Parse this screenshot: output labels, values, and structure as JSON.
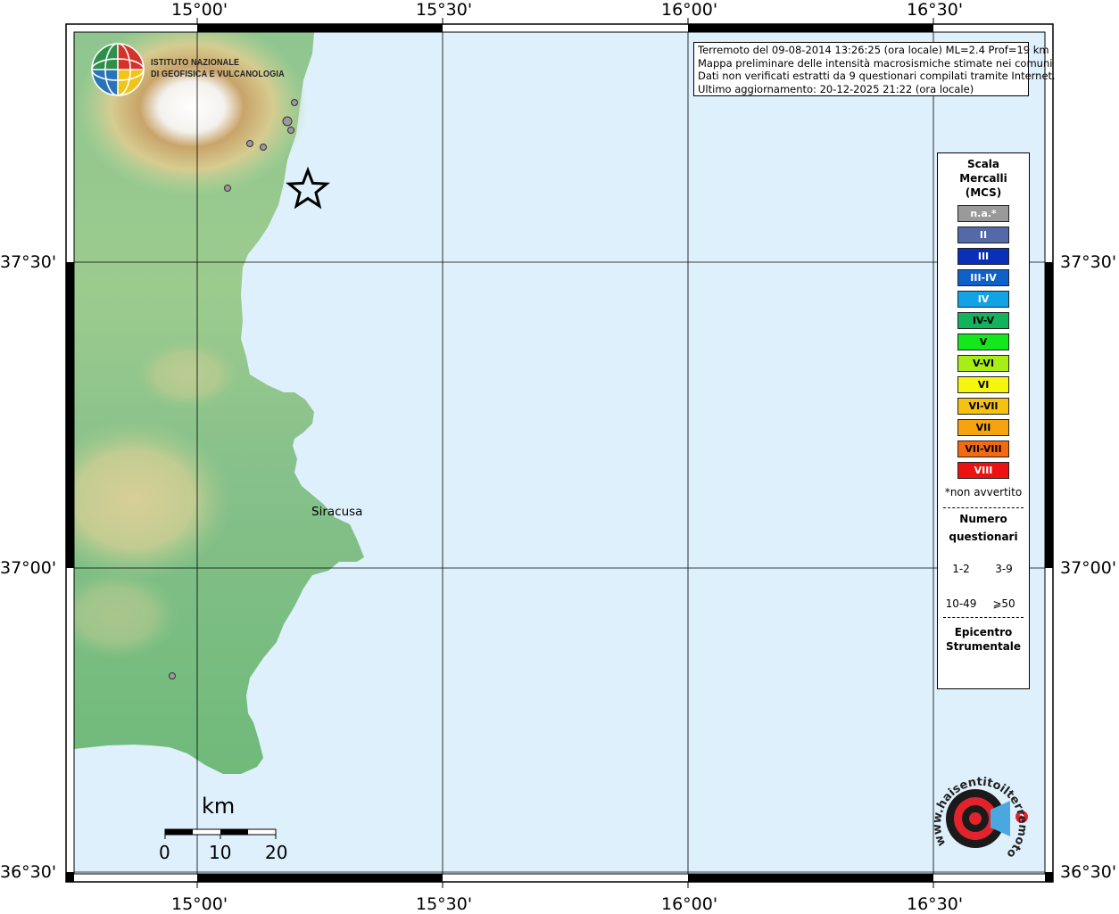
{
  "header_info": {
    "line1": "Terremoto del 09-08-2014 13:26:25 (ora locale) ML=2.4 Prof=19 km",
    "line2": "Mappa preliminare delle intensità macrosismiche stimate nei comuni",
    "line3": "Dati non verificati estratti da 9 questionari compilati tramite Internet.",
    "line4": "Ultimo aggiornamento: 20-12-2025 21:22 (ora locale)"
  },
  "logo": {
    "line1": "ISTITUTO NAZIONALE",
    "line2": "DI GEOFISICA E VULCANOLOGIA"
  },
  "axes": {
    "longitude_labels": [
      "15°00'",
      "15°30'",
      "16°00'",
      "16°30'"
    ],
    "latitude_labels": [
      "37°30'",
      "37°00'",
      "36°30'"
    ]
  },
  "places": {
    "city": "Siracusa"
  },
  "scale_bar": {
    "unit": "km",
    "ticks": [
      "0",
      "10",
      "20"
    ]
  },
  "legend": {
    "title_line1": "Scala",
    "title_line2": "Mercalli",
    "title_line3": "(MCS)",
    "classes": [
      {
        "label": "n.a.*",
        "color": "#9a9a9a",
        "text_color": "#ffffff"
      },
      {
        "label": "II",
        "color": "#5469a8",
        "text_color": "#ffffff"
      },
      {
        "label": "III",
        "color": "#0a2fb8",
        "text_color": "#ffffff"
      },
      {
        "label": "III-IV",
        "color": "#0f61c9",
        "text_color": "#ffffff"
      },
      {
        "label": "IV",
        "color": "#11a3e6",
        "text_color": "#ffffff"
      },
      {
        "label": "IV-V",
        "color": "#13b25d",
        "text_color": "#000000"
      },
      {
        "label": "V",
        "color": "#14e81c",
        "text_color": "#000000"
      },
      {
        "label": "V-VI",
        "color": "#a6ee15",
        "text_color": "#000000"
      },
      {
        "label": "VI",
        "color": "#f5f50f",
        "text_color": "#000000"
      },
      {
        "label": "VI-VII",
        "color": "#f5c20f",
        "text_color": "#000000"
      },
      {
        "label": "VII",
        "color": "#f5a40f",
        "text_color": "#000000"
      },
      {
        "label": "VII-VIII",
        "color": "#f56a0f",
        "text_color": "#000000"
      },
      {
        "label": "VIII",
        "color": "#ee1111",
        "text_color": "#ffffff"
      }
    ],
    "not_felt_note": "*non avvertito",
    "questionnaire_title_line1": "Numero",
    "questionnaire_title_line2": "questionari",
    "size_classes": [
      "1-2",
      "3-9",
      "10-49",
      "⩾50"
    ],
    "epicenter_line1": "Epicentro",
    "epicenter_line2": "Strumentale"
  },
  "watermark": {
    "site": "www.haisentitoilterremoto.it"
  },
  "colors": {
    "sea": "#def0fb",
    "land_low": "#7cbf7c",
    "land_mid": "#c9c78e",
    "land_high": "#b08a4c",
    "peak": "#ffffff",
    "observation_point": "#9a9a9a",
    "graticule": "#000000"
  }
}
